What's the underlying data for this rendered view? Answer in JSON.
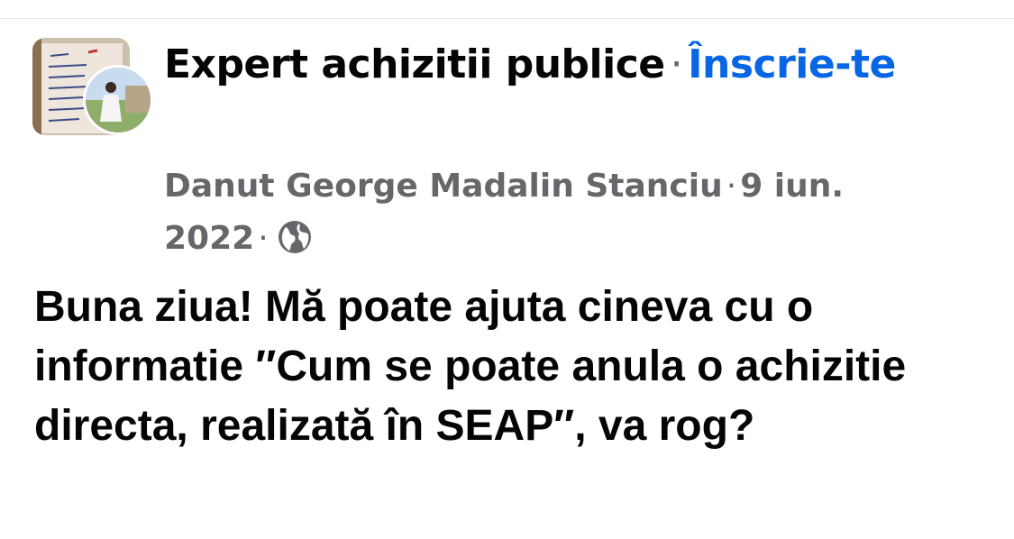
{
  "group": {
    "name": "Expert achizitii publice",
    "separator": "·",
    "join_label": "Înscrie-te"
  },
  "post": {
    "author": "Danut George Madalin Stanciu",
    "separator": "·",
    "date": "9 iun. 2022",
    "audience_icon": "globe-icon",
    "text": "Buna ziua! Mă poate ajuta cineva cu o informatie ″Cum se poate anula o achizitie directa, realizată în SEAP″, va rog?"
  },
  "colors": {
    "text_primary": "#050505",
    "text_secondary": "#65676b",
    "link": "#0866e4"
  }
}
